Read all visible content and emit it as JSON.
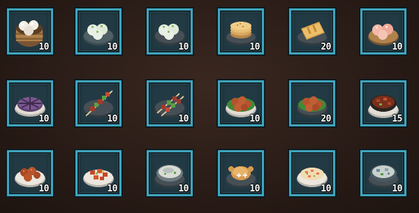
{
  "inventory": {
    "slots": [
      {
        "icon": "steamed-buns-basket-icon",
        "qty": "10"
      },
      {
        "icon": "dumplings-plate-icon",
        "qty": "10"
      },
      {
        "icon": "dumplings-plate-icon",
        "qty": "10"
      },
      {
        "icon": "flatbread-stack-icon",
        "qty": "10"
      },
      {
        "icon": "spring-roll-icon",
        "qty": "20"
      },
      {
        "icon": "peach-buns-icon",
        "qty": "10"
      },
      {
        "icon": "purple-pie-icon",
        "qty": "10"
      },
      {
        "icon": "skewer-icon",
        "qty": "10"
      },
      {
        "icon": "skewers-plate-icon",
        "qty": "10"
      },
      {
        "icon": "meatballs-greens-icon",
        "qty": "10"
      },
      {
        "icon": "meatballs-greens-icon",
        "qty": "20"
      },
      {
        "icon": "stew-bowl-icon",
        "qty": "15"
      },
      {
        "icon": "fried-meatballs-plate-icon",
        "qty": "10"
      },
      {
        "icon": "sweet-sour-pork-icon",
        "qty": "10"
      },
      {
        "icon": "fish-soup-bowl-icon",
        "qty": "10"
      },
      {
        "icon": "roast-chicken-icon",
        "qty": "10"
      },
      {
        "icon": "shrimp-fried-rice-icon",
        "qty": "10"
      },
      {
        "icon": "seafood-stew-icon",
        "qty": "10"
      }
    ]
  }
}
